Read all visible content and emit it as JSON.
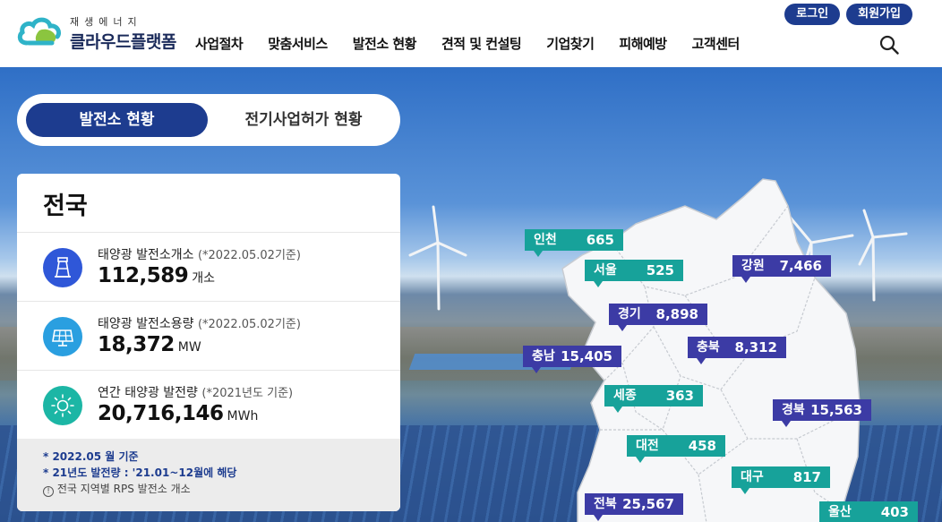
{
  "header": {
    "logo_sub": "재생에너지",
    "logo_main": "클라우드플랫폼",
    "nav": [
      "사업절차",
      "맞춤서비스",
      "발전소 현황",
      "견적 및 컨설팅",
      "기업찾기",
      "피해예방",
      "고객센터"
    ],
    "login": "로그인",
    "signup": "회원가입",
    "search_icon": "search-icon"
  },
  "tabs": {
    "active": "발전소 현황",
    "other": "전기사업허가 현황"
  },
  "card": {
    "title": "전국",
    "stats": [
      {
        "label": "태양광 발전소개소",
        "date": "(*2022.05.02기준)",
        "value": "112,589",
        "unit": "개소",
        "icon": "solar-plant-icon",
        "color": "#2f57d8"
      },
      {
        "label": "태양광 발전소용량",
        "date": "(*2022.05.02기준)",
        "value": "18,372",
        "unit": "MW",
        "icon": "solar-panel-icon",
        "color": "#2a9fe0"
      },
      {
        "label": "연간 태양광 발전량",
        "date": "(*2021년도 기준)",
        "value": "20,716,146",
        "unit": "MWh",
        "icon": "sun-icon",
        "color": "#1cb6a5"
      }
    ],
    "notes": [
      "* 2022.05 월 기준",
      "* 21년도 발전량 : '21.01~12월에 해당"
    ],
    "info": "전국 지역별 RPS 발전소 개소"
  },
  "regions": [
    {
      "name": "인천",
      "value": "665",
      "color": "teal"
    },
    {
      "name": "서울",
      "value": "525",
      "color": "teal"
    },
    {
      "name": "강원",
      "value": "7,466",
      "color": "purple"
    },
    {
      "name": "경기",
      "value": "8,898",
      "color": "purple"
    },
    {
      "name": "충남",
      "value": "15,405",
      "color": "purple"
    },
    {
      "name": "충북",
      "value": "8,312",
      "color": "purple"
    },
    {
      "name": "세종",
      "value": "363",
      "color": "teal"
    },
    {
      "name": "경북",
      "value": "15,563",
      "color": "purple"
    },
    {
      "name": "대전",
      "value": "458",
      "color": "teal"
    },
    {
      "name": "대구",
      "value": "817",
      "color": "teal"
    },
    {
      "name": "전북",
      "value": "25,567",
      "color": "purple"
    },
    {
      "name": "울산",
      "value": "403",
      "color": "teal"
    }
  ]
}
